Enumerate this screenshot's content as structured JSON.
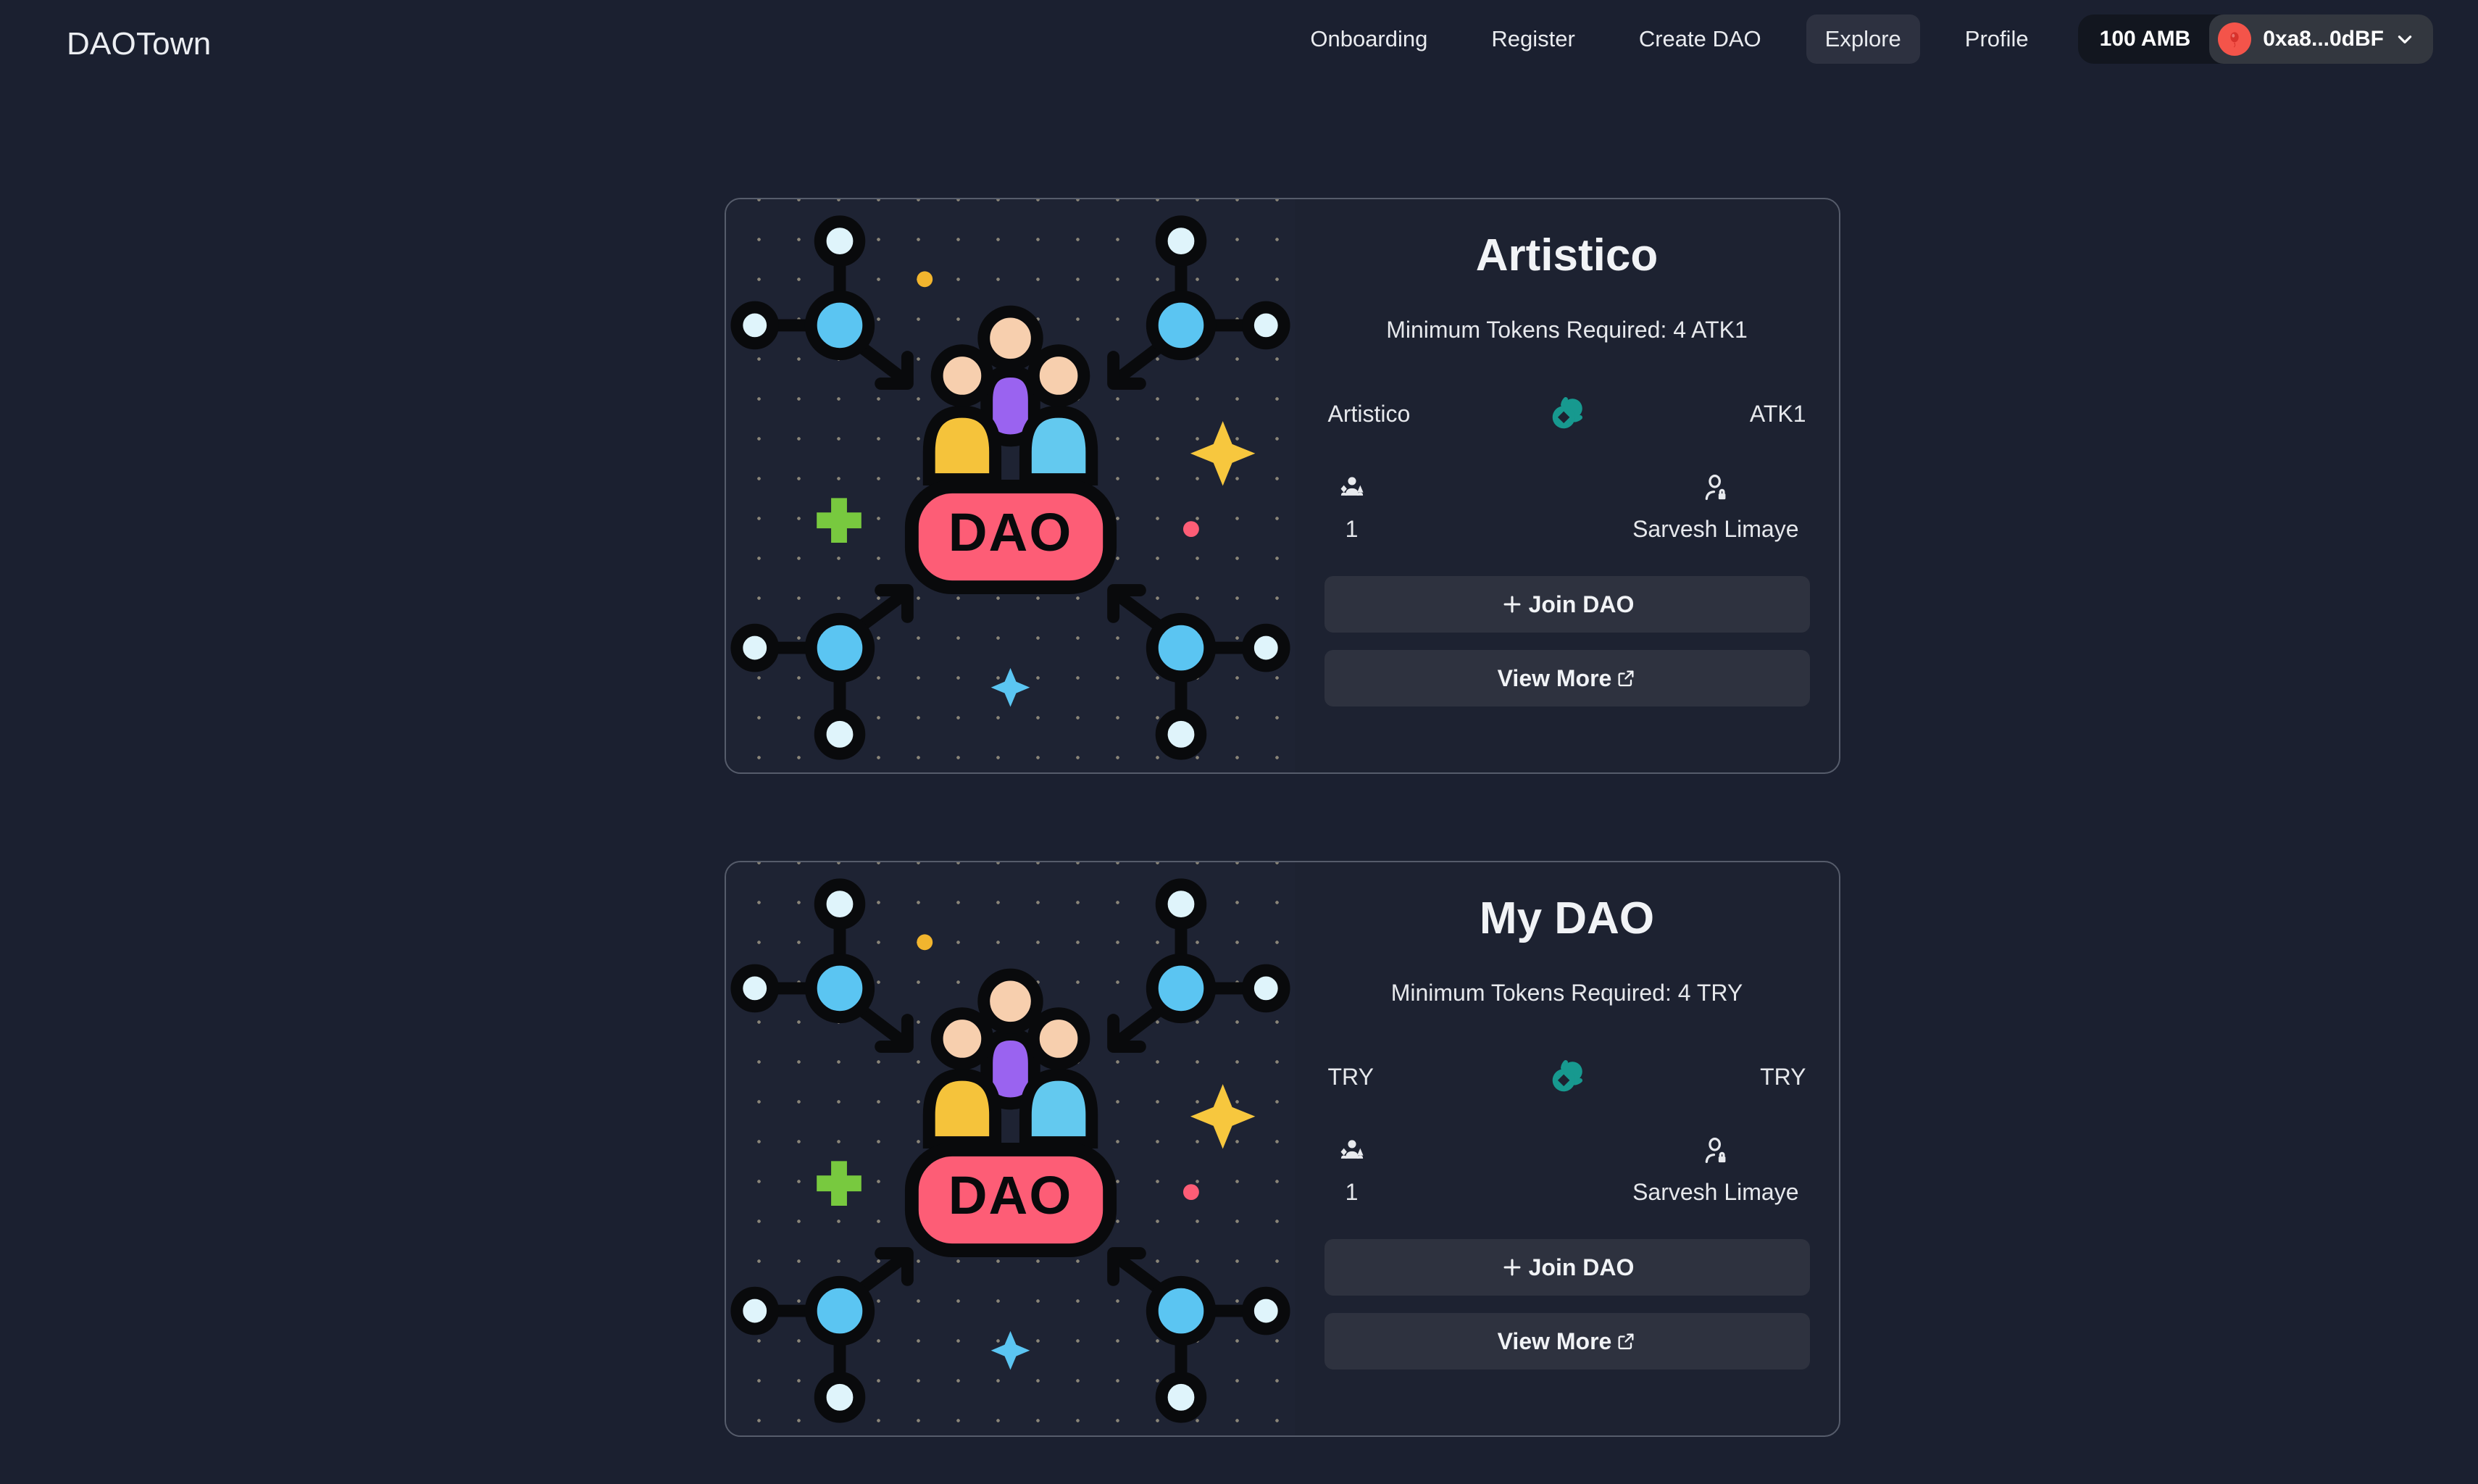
{
  "brand": "DAOTown",
  "nav": {
    "links": [
      {
        "label": "Onboarding",
        "active": false
      },
      {
        "label": "Register",
        "active": false
      },
      {
        "label": "Create DAO",
        "active": false
      },
      {
        "label": "Explore",
        "active": true
      },
      {
        "label": "Profile",
        "active": false
      }
    ],
    "wallet": {
      "balance": "100 AMB",
      "address": "0xa8...0dBF",
      "avatar_icon": "balloon-emoji-avatar",
      "chevron_icon": "chevron-down-icon"
    }
  },
  "colors": {
    "page_bg": "#1b2030",
    "card_bg": "#1d2231",
    "card_border": "#565c6b",
    "button_bg": "#2e323f",
    "text_primary": "#f1f3f6",
    "text_secondary": "#e6e8ec",
    "nav_active_bg": "#2d3140",
    "token_icon": "#17998f",
    "wallet_avatar": "#f4544a",
    "illustration": {
      "node_blue": "#5bc5f2",
      "node_white": "#dff4fb",
      "badge_pink": "#fd5d76",
      "person_skin": "#f7cfae",
      "person_yellow": "#f5c33b",
      "person_cyan": "#63c9ef",
      "person_purple": "#9a63f0",
      "sparkle_yellow": "#f7c73e",
      "sparkle_blue": "#5bc5f2",
      "plus_green": "#77c council",
      "dot_orange": "#f2b52e",
      "dot_pink": "#fd5d76",
      "outline": "#090a0c"
    }
  },
  "illustration": {
    "name": "dao-network-illustration",
    "badge_text": "DAO"
  },
  "labels": {
    "min_tokens_prefix": "Minimum Tokens Required: ",
    "join_label": "Join DAO",
    "view_more_label": "View More",
    "plus_icon": "plus-icon",
    "external_link_icon": "external-link-icon",
    "members_icon": "users-group-icon",
    "owner_icon": "person-lock-icon",
    "coins_icon": "coins-icon"
  },
  "cards": [
    {
      "title": "Artistico",
      "min_tokens_text": "Minimum Tokens Required: 4 ATK1",
      "token_name": "Artistico",
      "token_symbol": "ATK1",
      "members_count": "1",
      "owner_name": "Sarvesh Limaye",
      "join_label": "Join DAO",
      "view_more_label": "View More"
    },
    {
      "title": "My DAO",
      "min_tokens_text": "Minimum Tokens Required: 4 TRY",
      "token_name": "TRY",
      "token_symbol": "TRY",
      "members_count": "1",
      "owner_name": "Sarvesh Limaye",
      "join_label": "Join DAO",
      "view_more_label": "View More"
    }
  ]
}
